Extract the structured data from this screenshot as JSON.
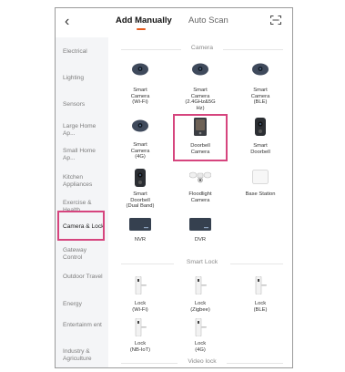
{
  "header": {
    "back_icon": "‹",
    "tab_manual": "Add Manually",
    "tab_auto": "Auto Scan",
    "accent_color": "#e55a1c"
  },
  "sidebar": {
    "items": [
      {
        "label": "Electrical"
      },
      {
        "label": "Lighting"
      },
      {
        "label": "Sensors"
      },
      {
        "label": "Large Home Ap..."
      },
      {
        "label": "Small Home Ap..."
      },
      {
        "label": "Kitchen Appliances"
      },
      {
        "label": "Exercise & Health"
      },
      {
        "label": "Camera & Lock"
      },
      {
        "label": "Gateway Control"
      },
      {
        "label": "Outdoor Travel"
      },
      {
        "label": "Energy"
      },
      {
        "label": "Entertainm ent"
      },
      {
        "label": "Industry & Agriculture"
      }
    ],
    "active": "Camera & Lock",
    "highlight_color": "#d6457e"
  },
  "sections": {
    "camera": "Camera",
    "smart_lock": "Smart Lock",
    "video_lock": "Video lock"
  },
  "devices": {
    "cam_wifi": [
      "Smart",
      "Camera",
      "(Wi-Fi)"
    ],
    "cam_24": [
      "Smart",
      "Camera",
      "(2.4GHz&5G",
      "Hz)"
    ],
    "cam_ble": [
      "Smart",
      "Camera",
      "(BLE)"
    ],
    "cam_4g": [
      "Smart",
      "Camera",
      "(4G)"
    ],
    "doorbell_cam": [
      "Doorbell",
      "Camera"
    ],
    "smart_doorbell": [
      "Smart",
      "Doorbell"
    ],
    "doorbell_dual": [
      "Smart",
      "Doorbell",
      "(Dual Band)"
    ],
    "floodlight": [
      "Floodlight",
      "Camera"
    ],
    "base_station": [
      "Base Station"
    ],
    "nvr": [
      "NVR"
    ],
    "dvr": [
      "DVR"
    ],
    "lock_wifi": [
      "Lock",
      "(Wi-Fi)"
    ],
    "lock_zigbee": [
      "Lock",
      "(Zigbee)"
    ],
    "lock_ble": [
      "Lock",
      "(BLE)"
    ],
    "lock_nbiot": [
      "Lock",
      "(NB-IoT)"
    ],
    "lock_4g": [
      "Lock",
      "(4G)"
    ]
  }
}
